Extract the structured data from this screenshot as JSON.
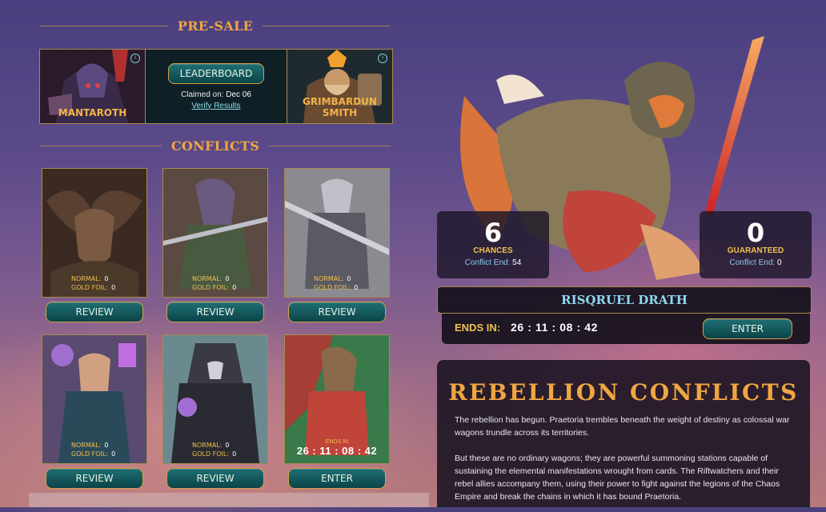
{
  "presale": {
    "title": "PRE-SALE",
    "left_card_name": "MANTAROTH",
    "right_card_name": "GRIMBARDUN SMITH",
    "leaderboard_label": "LEADERBOARD",
    "claimed_label": "Claimed on:",
    "claimed_date": "Dec 06",
    "verify_label": "Verify Results"
  },
  "conflicts": {
    "title": "CONFLICTS",
    "normal_label": "NORMAL:",
    "goldfoil_label": "GOLD FOIL:",
    "cards": [
      {
        "normal": "0",
        "goldfoil": "0",
        "button": "REVIEW"
      },
      {
        "normal": "0",
        "goldfoil": "0",
        "button": "REVIEW"
      },
      {
        "normal": "0",
        "goldfoil": "0",
        "button": "REVIEW"
      },
      {
        "normal": "0",
        "goldfoil": "0",
        "button": "REVIEW"
      },
      {
        "normal": "0",
        "goldfoil": "0",
        "button": "REVIEW"
      },
      {
        "ends_label": "ENDS IN",
        "ends_value": "26 : 11 : 08 : 42",
        "button": "ENTER"
      }
    ]
  },
  "stats": {
    "chances_value": "6",
    "chances_label": "CHANCES",
    "chances_sub_label": "Conflict End:",
    "chances_sub_value": "54",
    "guaranteed_value": "0",
    "guaranteed_label": "GUARANTEED",
    "guaranteed_sub_label": "Conflict End:",
    "guaranteed_sub_value": "0"
  },
  "boss": {
    "name": "RISQRUEL DRATH",
    "ends_label": "ENDS IN:",
    "ends_value": "26 : 11 : 08 : 42",
    "enter_label": "ENTER"
  },
  "info": {
    "title": "REBELLION CONFLICTS",
    "para1": "The rebellion has begun. Praetoria trembles beneath the weight of destiny as colossal war wagons trundle across its territories.",
    "para2": "But these are no ordinary wagons; they are powerful summoning stations capable of sustaining the elemental manifestations wrought from cards. The Riftwatchers and their rebel allies accompany them, using their power to fight against the legions of the Chaos Empire and break the chains in which it has bound Praetoria."
  },
  "colors": {
    "accent_gold": "#f0a640",
    "teal_button": "#1f6f73",
    "link_blue": "#8ee0e6"
  }
}
